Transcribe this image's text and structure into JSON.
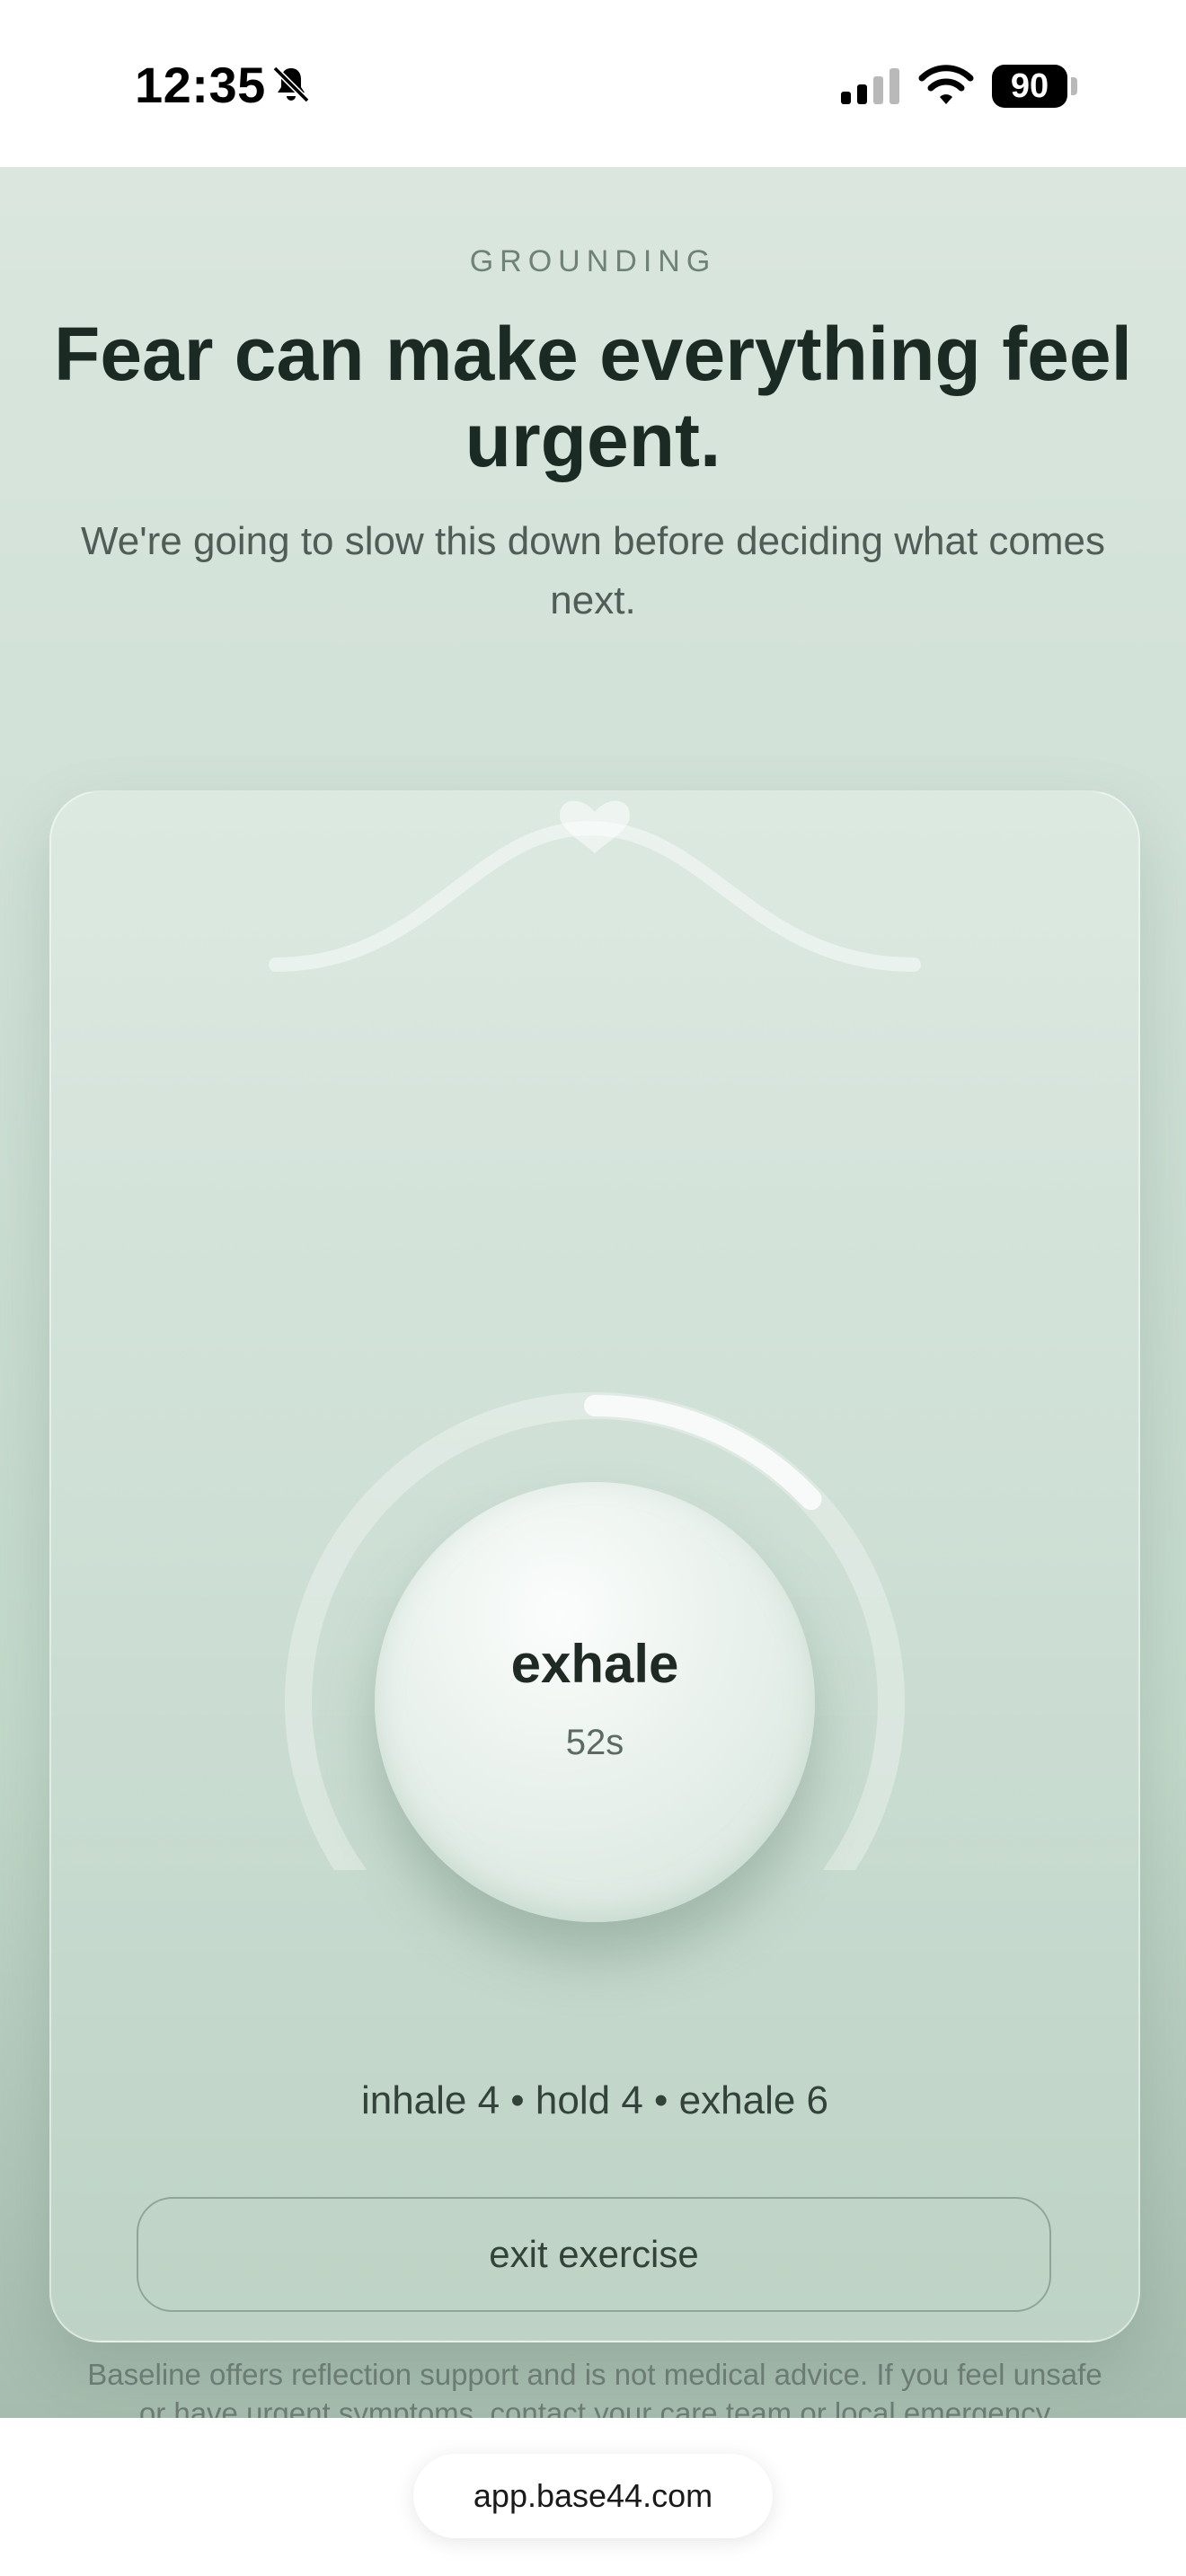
{
  "status_bar": {
    "time": "12:35",
    "battery": "90",
    "icons": [
      "bell-slash-icon",
      "cellular-signal-icon",
      "wifi-icon",
      "battery-icon"
    ]
  },
  "header": {
    "eyebrow": "GROUNDING",
    "title": "Fear can make everything feel urgent.",
    "subtitle": "We're going to slow this down before deciding what comes next."
  },
  "exercise": {
    "phase": "exhale",
    "remaining": "52s",
    "progress": 0.13,
    "rhythm": "inhale 4 • hold 4 • exhale 6",
    "exit_label": "exit exercise",
    "disclaimer": "Baseline offers reflection support and is not medical advice. If you feel unsafe or have urgent symptoms, contact your care team or local emergency services.",
    "icons": [
      "heart-icon"
    ]
  },
  "browser": {
    "url": "app.base44.com"
  },
  "colors": {
    "background_top": "#dae6de",
    "background_bottom": "#a5bcae",
    "text_dark": "#1b2a22",
    "text_muted": "#6e8277"
  }
}
